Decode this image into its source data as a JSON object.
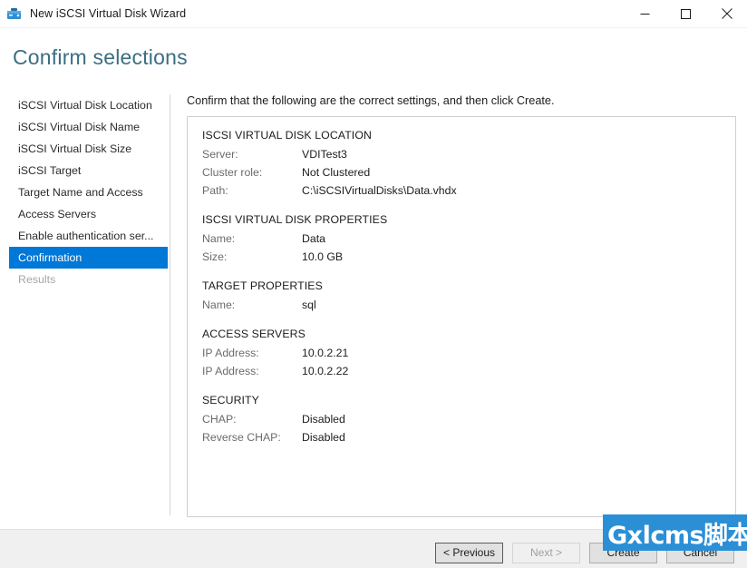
{
  "window": {
    "title": "New iSCSI Virtual Disk Wizard",
    "icon": "iscsi-disk-icon",
    "controls": {
      "minimize": "minimize-icon",
      "maximize": "maximize-icon",
      "close": "close-icon"
    }
  },
  "header": {
    "heading": "Confirm selections"
  },
  "sidebar": {
    "items": [
      {
        "label": "iSCSI Virtual Disk Location",
        "state": "normal"
      },
      {
        "label": "iSCSI Virtual Disk Name",
        "state": "normal"
      },
      {
        "label": "iSCSI Virtual Disk Size",
        "state": "normal"
      },
      {
        "label": "iSCSI Target",
        "state": "normal"
      },
      {
        "label": "Target Name and Access",
        "state": "normal"
      },
      {
        "label": "Access Servers",
        "state": "normal"
      },
      {
        "label": "Enable authentication ser...",
        "state": "normal"
      },
      {
        "label": "Confirmation",
        "state": "selected"
      },
      {
        "label": "Results",
        "state": "disabled"
      }
    ],
    "selected_color": "#0078d7"
  },
  "main": {
    "intro": "Confirm that the following are the correct settings, and then click Create.",
    "sections": [
      {
        "title": "ISCSI VIRTUAL DISK LOCATION",
        "rows": [
          {
            "label": "Server:",
            "value": "VDITest3"
          },
          {
            "label": "Cluster role:",
            "value": "Not Clustered"
          },
          {
            "label": "Path:",
            "value": "C:\\iSCSIVirtualDisks\\Data.vhdx"
          }
        ]
      },
      {
        "title": "ISCSI VIRTUAL DISK PROPERTIES",
        "rows": [
          {
            "label": "Name:",
            "value": "Data"
          },
          {
            "label": "Size:",
            "value": "10.0 GB"
          }
        ]
      },
      {
        "title": "TARGET PROPERTIES",
        "rows": [
          {
            "label": "Name:",
            "value": "sql"
          }
        ]
      },
      {
        "title": "ACCESS SERVERS",
        "rows": [
          {
            "label": "IP Address:",
            "value": "10.0.2.21"
          },
          {
            "label": "IP Address:",
            "value": "10.0.2.22"
          }
        ]
      },
      {
        "title": "SECURITY",
        "rows": [
          {
            "label": "CHAP:",
            "value": "Disabled"
          },
          {
            "label": "Reverse CHAP:",
            "value": "Disabled"
          }
        ]
      }
    ]
  },
  "footer": {
    "buttons": [
      {
        "label": "< Previous",
        "state": "focused"
      },
      {
        "label": "Next >",
        "state": "disabled"
      },
      {
        "label": "Create",
        "state": "normal"
      },
      {
        "label": "Cancel",
        "state": "normal"
      }
    ]
  },
  "watermark": {
    "text": "Gxlcms脚本",
    "color": "#2b8fd6"
  }
}
